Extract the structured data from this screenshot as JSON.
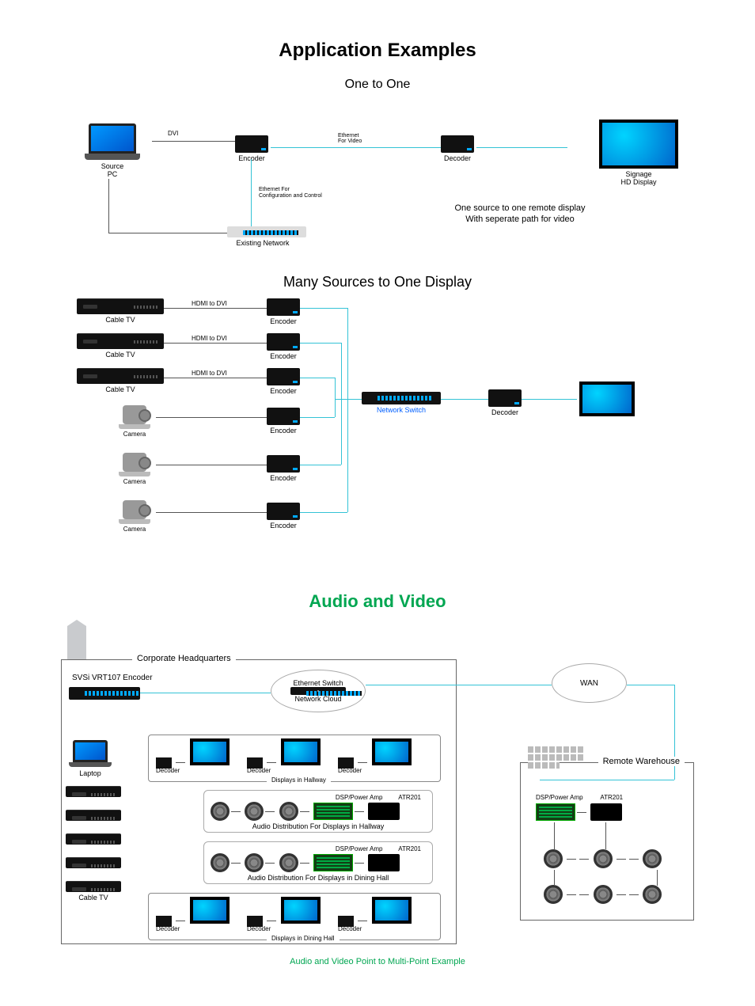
{
  "title": "Application Examples",
  "diagram1": {
    "subtitle": "One to One",
    "source_pc": "Source\nPC",
    "encoder": "Encoder",
    "decoder": "Decoder",
    "display": "Signage\nHD Display",
    "existing_network": "Existing Network",
    "dvi_label": "DVI",
    "eth_video_label": "Ethernet\nFor Video",
    "eth_config_label": "Ethernet For\nConfiguration and Control",
    "description": "One source to one remote display\nWith seperate path for video"
  },
  "diagram2": {
    "subtitle": "Many Sources to One Display",
    "source_cable": "Cable TV",
    "source_camera": "Camera",
    "hdmi_label": "HDMI to DVI",
    "encoder": "Encoder",
    "network_switch": "Network Switch",
    "decoder": "Decoder"
  },
  "diagram3": {
    "title_av": "Audio and Video",
    "hq_label": "Corporate Headquarters",
    "rw_label": "Remote Warehouse",
    "encoder_label": "SVSi VRT107 Encoder",
    "eth_switch": "Ethernet Switch",
    "net_cloud": "Network Cloud",
    "wan": "WAN",
    "laptop": "Laptop",
    "cable_tv": "Cable TV",
    "decoder": "Decoder",
    "displays_hallway": "Displays in Hallway",
    "displays_dining": "Displays in Dining Hall",
    "dsp_amp": "DSP/Power Amp",
    "atr201": "ATR201",
    "audio_hallway": "Audio Distribution For Displays in Hallway",
    "audio_dining": "Audio Distribution For Displays in Dining Hall",
    "caption": "Audio and Video Point to Multi-Point Example"
  }
}
